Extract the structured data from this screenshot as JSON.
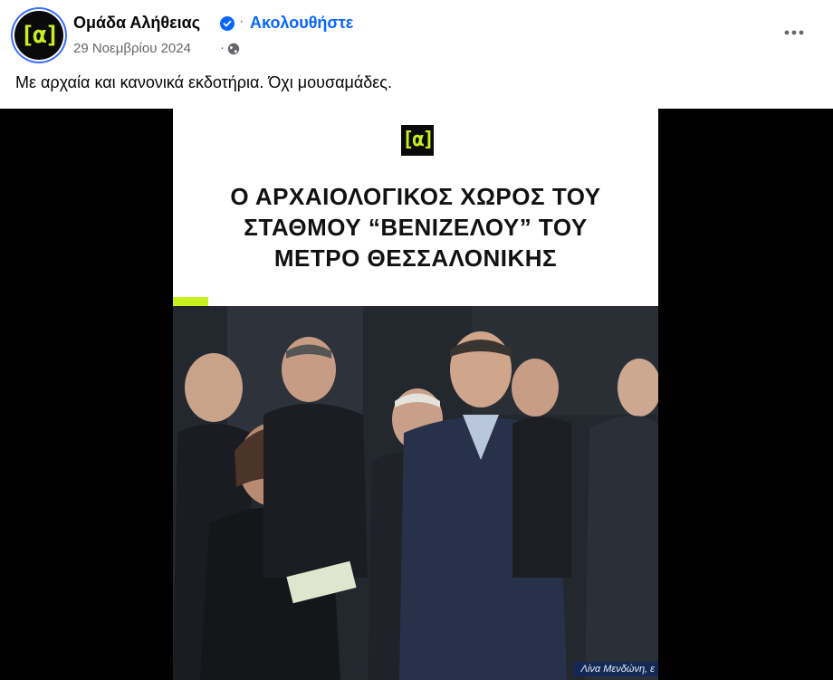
{
  "header": {
    "page_name": "Ομάδα Αλήθειας",
    "follow_label": "Ακολουθήστε",
    "separator": "·",
    "date": "29 Νοεμβρίου 2024",
    "logo_text": "[α]"
  },
  "post": {
    "text": "Με αρχαία και κανονικά εκδοτήρια. Όχι μουσαμάδες."
  },
  "media": {
    "logo_text": "[α]",
    "title": "Ο ΑΡΧΑΙΟΛΟΓΙΚΟΣ ΧΩΡΟΣ ΤΟΥ\nΣΤΑΘΜΟΥ “ΒΕΝΙΖΕΛΟΥ” ΤΟΥ\nΜΕΤΡΟ ΘΕΣΣΑΛΟΝΙΚΗΣ",
    "caption": "Λίνα Μενδώνη, ε"
  },
  "colors": {
    "accent": "#c8f01e",
    "link": "#0866ff",
    "verified": "#0866ff",
    "muted": "#65676b"
  },
  "icons": [
    "verified-badge-icon",
    "globe-icon",
    "more-options-icon"
  ]
}
